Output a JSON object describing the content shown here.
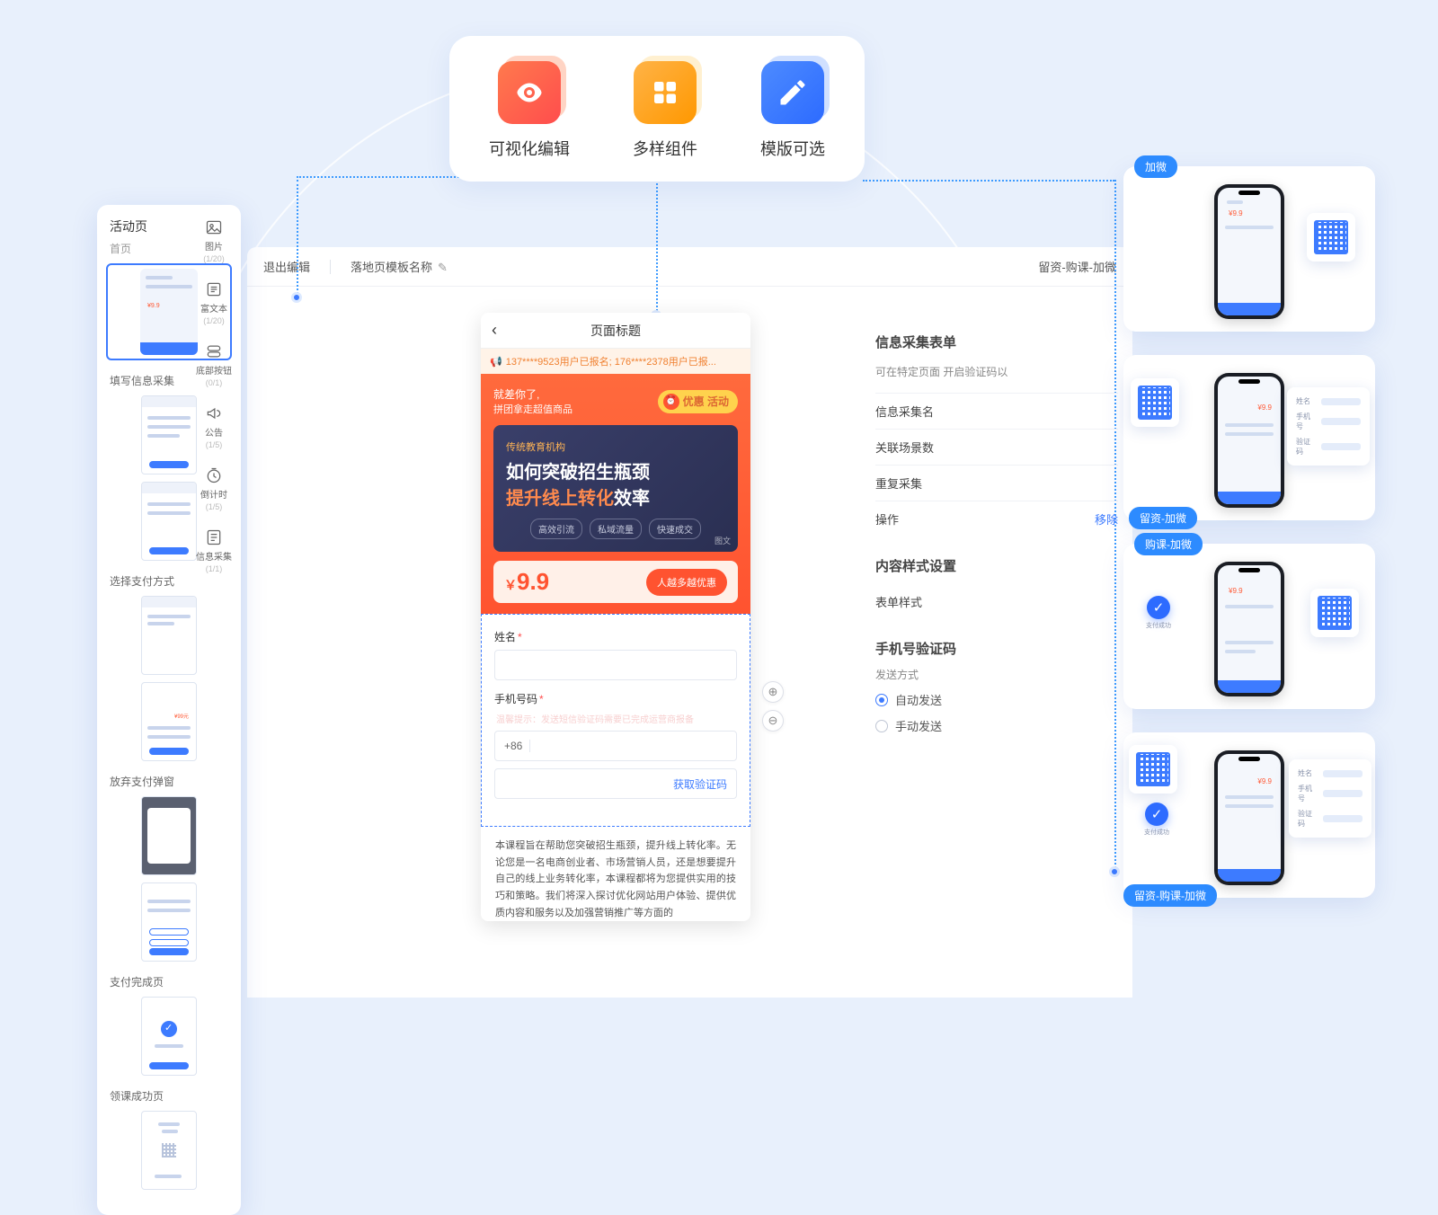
{
  "features": [
    {
      "label": "可视化编辑",
      "icon": "eye"
    },
    {
      "label": "多样组件",
      "icon": "grid"
    },
    {
      "label": "模版可选",
      "icon": "pencil"
    }
  ],
  "leftPanel": {
    "title": "活动页",
    "subtitle": "首页",
    "mini_price": "¥9.9",
    "sections": [
      {
        "label": "填写信息采集"
      },
      {
        "label": "选择支付方式"
      },
      {
        "label": "放弃支付弹窗"
      },
      {
        "label": "支付完成页"
      },
      {
        "label": "领课成功页"
      }
    ]
  },
  "components": [
    {
      "name": "图片",
      "count": "(1/20)"
    },
    {
      "name": "富文本",
      "count": "(1/20)"
    },
    {
      "name": "底部按钮",
      "count": "(0/1)"
    },
    {
      "name": "公告",
      "count": "(1/5)"
    },
    {
      "name": "倒计时",
      "count": "(1/5)"
    },
    {
      "name": "信息采集",
      "count": "(1/1)"
    }
  ],
  "editor": {
    "back": "退出编辑",
    "title": "落地页模板名称",
    "path": "留资-购课-加微"
  },
  "preview": {
    "title": "页面标题",
    "ticker": "137****9523用户已报名; 176****2378用户已报...",
    "promo_line1": "就差你了,",
    "promo_line2": "拼团拿走超值商品",
    "pill": "优惠 活动",
    "hero_s1": "传统教育机构",
    "hero_s2": "如何突破招生瓶颈",
    "hero_s3_a": "提升",
    "hero_s3_b": "线上转化",
    "hero_s3_c": "效率",
    "hero_tags": [
      "高效引流",
      "私域流量",
      "快速成交"
    ],
    "hero_corner": "图文",
    "price": "9.9",
    "price_currency": "￥",
    "price_btn": "人越多越优惠",
    "form": {
      "name_label": "姓名",
      "phone_label": "手机号码",
      "phone_hint": "温馨提示：发送短信验证码需要已完成运营商报备",
      "prefix": "+86",
      "get_code": "获取验证码"
    },
    "desc": "本课程旨在帮助您突破招生瓶颈，提升线上转化率。无论您是一名电商创业者、市场营销人员，还是想要提升自己的线上业务转化率，本课程都将为您提供实用的技巧和策略。我们将深入探讨优化网站用户体验、提供优质内容和服务以及加强营销推广等方面的"
  },
  "props": {
    "h1": "信息采集表单",
    "muted": "可在特定页面\n开启验证码以",
    "rows": [
      {
        "k": "信息采集名",
        "v": ""
      },
      {
        "k": "关联场景数",
        "v": ""
      },
      {
        "k": "重复采集",
        "v": ""
      },
      {
        "k": "操作",
        "v": "移除",
        "link": true
      }
    ],
    "h2": "内容样式设置",
    "style_row": "表单样式",
    "h3": "手机号验证码",
    "send_label": "发送方式",
    "auto": "自动发送",
    "manual": "手动发送"
  },
  "chips": [
    "加微",
    "留资-加微",
    "购课-加微",
    "留资-购课-加微"
  ],
  "fieldCard": {
    "f1": "姓名",
    "f2": "手机号",
    "f3": "验证码"
  },
  "ok_label": "支付成功",
  "mini99": "¥9.9"
}
